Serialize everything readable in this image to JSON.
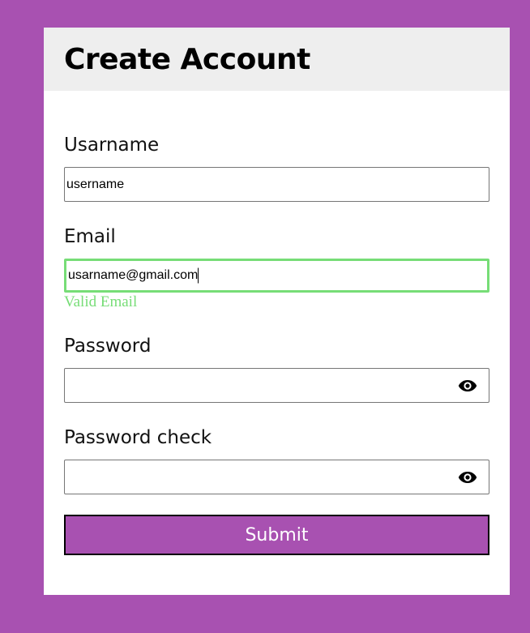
{
  "header": {
    "title": "Create Account"
  },
  "fields": {
    "username": {
      "label": "Usarname",
      "value": "username"
    },
    "email": {
      "label": "Email",
      "value": "usarname@gmail.com",
      "status": "Valid Email"
    },
    "password": {
      "label": "Password",
      "value": ""
    },
    "password_check": {
      "label": "Password check",
      "value": ""
    }
  },
  "submit": {
    "label": "Submit"
  },
  "colors": {
    "page_background": "#a851b1",
    "valid": "#77dd77",
    "header_background": "#eeeeee",
    "button": "#a851b1"
  },
  "icons": {
    "password_toggle": "eye-icon"
  }
}
